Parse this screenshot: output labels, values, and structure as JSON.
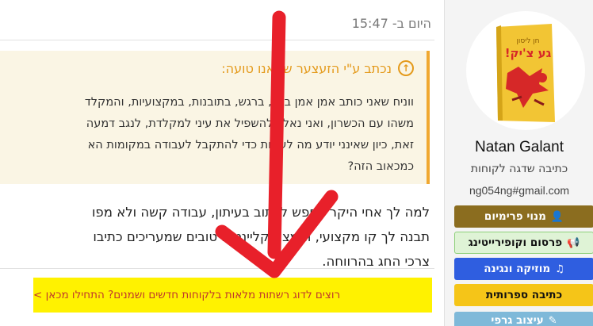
{
  "post": {
    "timestamp": "היום ב- 15:47",
    "quote_header": "נכתב ע\"י הזעצער שמאנו טועה:",
    "quote_lines": [
      "ווניח שאני כותב אמן אמן בכל, ברגש, בתובנות, במקצועיות, והמקלד",
      "משהו עם הכשרון, ואני נאלץ להשפיל את עיני למקלדת, לנגב דמעה",
      "זאת, כיון שאינני יודע מה לעשות כדי להתקבל לעבודה במקומות הא",
      "כמכאוב הזה?"
    ],
    "body_lines": [
      "למה לך אחי היקר לחפש לכתוב בעיתון, עבודה קשה ולא מפו",
      "תבנה לך קו מקצועי, ותמצא קליינטים טובים שמעריכים כתיבו",
      "צרכי החג בהרווחה."
    ],
    "promo_link": "רוצים לדוג רשתות מלאות בלקוחות חדשים ושמנים? התחילו מכאן >"
  },
  "profile": {
    "book_title": "גע צ'יק!",
    "book_author": "חן ליסון",
    "name": "Natan Galant",
    "title": "כתיבה שדגה לקוחות",
    "email": "ng054ng#gmail.com",
    "buttons": [
      {
        "label": "מנוי פרימיום",
        "icon": "user-icon"
      },
      {
        "label": "פרסום וקופירייטינג",
        "icon": "megaphone-icon"
      },
      {
        "label": "מוזיקה ונגינה",
        "icon": "music-note-icon"
      },
      {
        "label": "כתיבה ספרותית",
        "icon": ""
      },
      {
        "label": "עיצוב גרפי",
        "icon": "pencil-icon"
      }
    ]
  },
  "colors": {
    "quote_accent": "#f0a830",
    "promo_highlight": "#fff200",
    "annotation_arrow": "#e8202a",
    "premium": "#8b6d1f",
    "music": "#2f5ee0",
    "literary": "#f5c518"
  }
}
